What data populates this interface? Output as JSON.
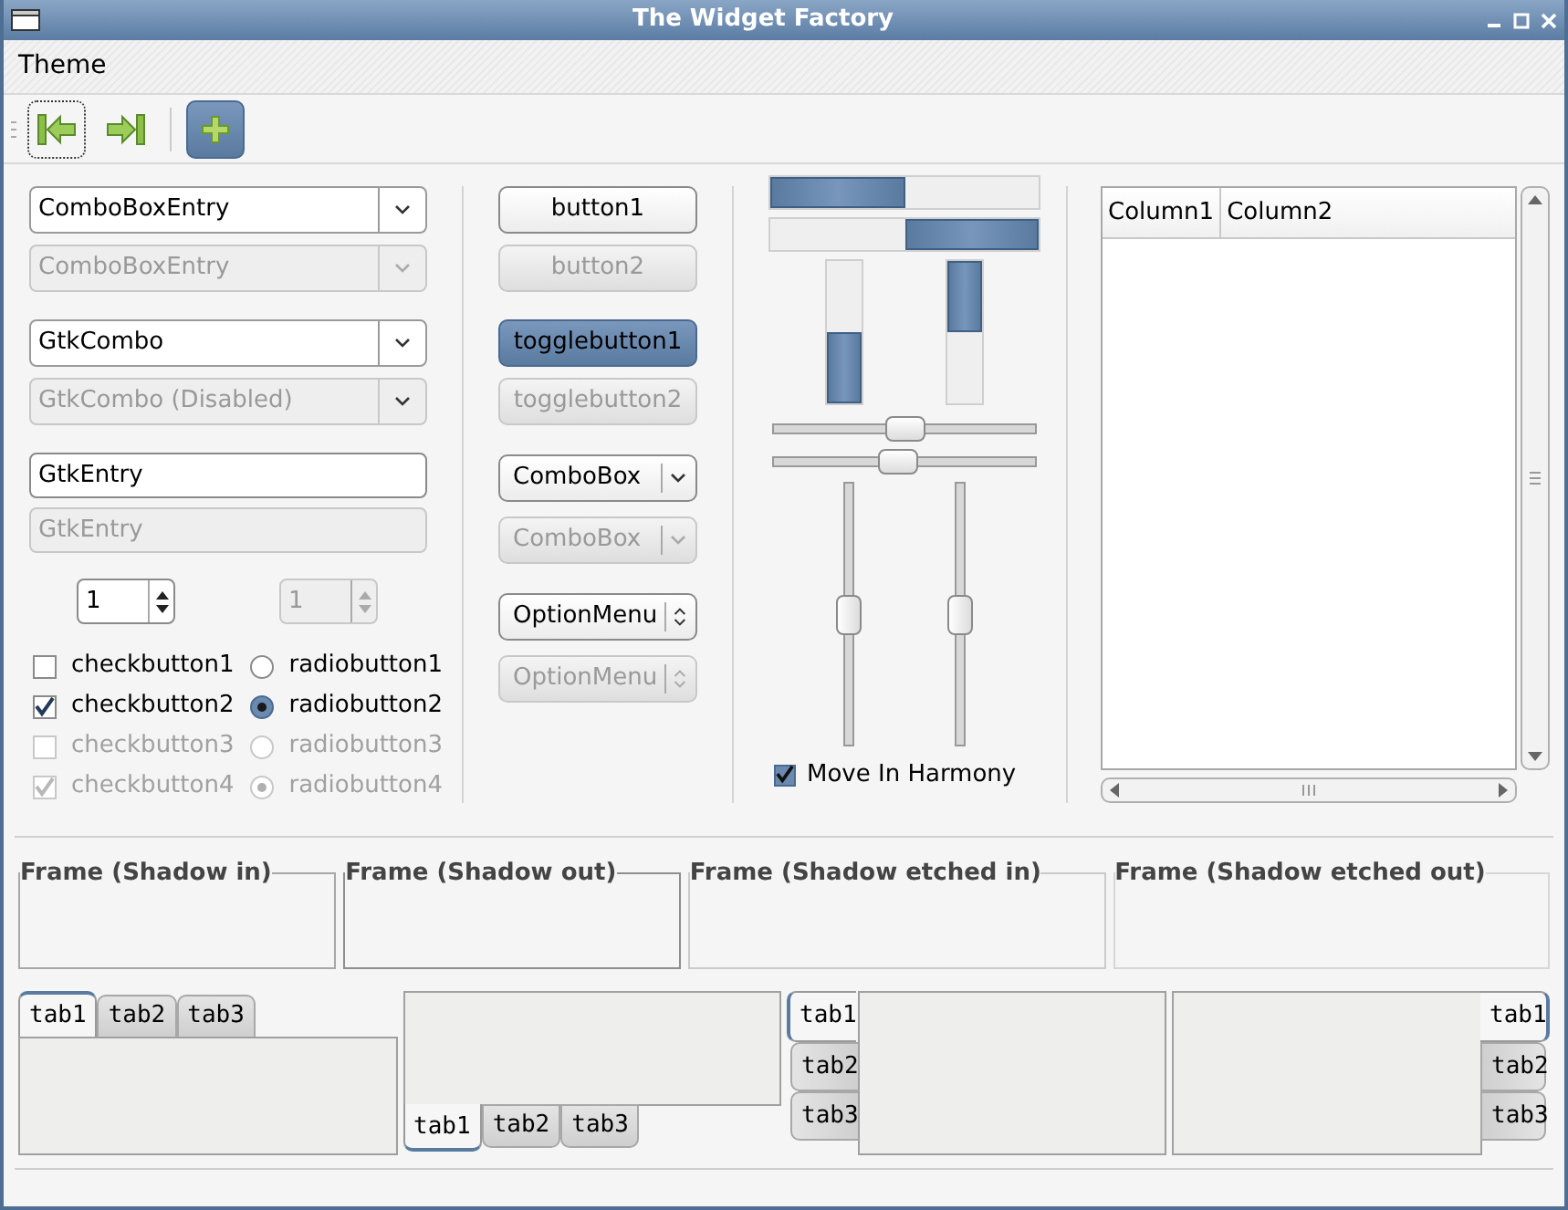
{
  "window": {
    "title": "The Widget Factory"
  },
  "menu": [
    {
      "label": "Theme"
    }
  ],
  "toolbar": [
    {
      "kind": "first",
      "focused": true,
      "active": false
    },
    {
      "kind": "last",
      "focused": false,
      "active": false
    },
    {
      "kind": "add",
      "focused": false,
      "active": true
    }
  ],
  "combo_entries": [
    {
      "kind": "combo-entry",
      "value": "ComboBoxEntry",
      "disabled": false
    },
    {
      "kind": "combo-entry",
      "value": "ComboBoxEntry",
      "disabled": true
    },
    {
      "kind": "gtk-combo",
      "value": "GtkCombo",
      "disabled": false
    },
    {
      "kind": "gtk-combo",
      "value": "GtkCombo (Disabled)",
      "disabled": true
    }
  ],
  "entries": [
    {
      "value": "GtkEntry",
      "disabled": false
    },
    {
      "value": "GtkEntry",
      "disabled": true
    }
  ],
  "spin_buttons": [
    {
      "value": "1",
      "disabled": false
    },
    {
      "value": "1",
      "disabled": true
    }
  ],
  "check_buttons": [
    {
      "label": "checkbutton1",
      "checked": false,
      "disabled": false
    },
    {
      "label": "checkbutton2",
      "checked": true,
      "disabled": false
    },
    {
      "label": "checkbutton3",
      "checked": false,
      "disabled": true
    },
    {
      "label": "checkbutton4",
      "checked": true,
      "disabled": true
    }
  ],
  "radio_buttons": [
    {
      "label": "radiobutton1",
      "selected": false,
      "disabled": false
    },
    {
      "label": "radiobutton2",
      "selected": true,
      "disabled": false
    },
    {
      "label": "radiobutton3",
      "selected": false,
      "disabled": true
    },
    {
      "label": "radiobutton4",
      "selected": true,
      "disabled": true
    }
  ],
  "buttons": [
    {
      "label": "button1",
      "disabled": false
    },
    {
      "label": "button2",
      "disabled": true
    }
  ],
  "toggle_buttons": [
    {
      "label": "togglebutton1",
      "on": true,
      "disabled": false
    },
    {
      "label": "togglebutton2",
      "on": false,
      "disabled": true
    }
  ],
  "combo_boxes": [
    {
      "kind": "combo",
      "value": "ComboBox",
      "disabled": false
    },
    {
      "kind": "combo",
      "value": "ComboBox",
      "disabled": true
    },
    {
      "kind": "option-menu",
      "value": "OptionMenu",
      "disabled": false
    },
    {
      "kind": "option-menu",
      "value": "OptionMenu",
      "disabled": true
    }
  ],
  "progress_bars": [
    {
      "kind": "left-to-right",
      "level": 0.5
    },
    {
      "kind": "right-to-left",
      "level": 0.5
    },
    {
      "kind": "bottom-to-top",
      "level": 0.5
    },
    {
      "kind": "top-to-bottom",
      "level": 0.5
    }
  ],
  "scales": [
    {
      "kind": "horizontal",
      "level": 0.5
    },
    {
      "kind": "horizontal",
      "level": 0.47
    },
    {
      "kind": "vertical",
      "level": 0.5
    },
    {
      "kind": "vertical",
      "level": 0.5
    }
  ],
  "harmony": {
    "label": "Move In Harmony",
    "checked": true
  },
  "tree": {
    "columns": [
      "Column1",
      "Column2"
    ]
  },
  "frames": [
    {
      "label": "Frame (Shadow in)",
      "kind": "in"
    },
    {
      "label": "Frame (Shadow out)",
      "kind": "out"
    },
    {
      "label": "Frame (Shadow etched in)",
      "kind": "etched-in"
    },
    {
      "label": "Frame (Shadow etched out)",
      "kind": "etched-out"
    }
  ],
  "notebooks": [
    {
      "kind": "top",
      "tabs": [
        {
          "label": "tab1",
          "selected": true
        },
        {
          "label": "tab2",
          "selected": false
        },
        {
          "label": "tab3",
          "selected": false
        }
      ]
    },
    {
      "kind": "bottom",
      "tabs": [
        {
          "label": "tab1",
          "selected": true
        },
        {
          "label": "tab2",
          "selected": false
        },
        {
          "label": "tab3",
          "selected": false
        }
      ]
    },
    {
      "kind": "left",
      "tabs": [
        {
          "label": "tab1",
          "selected": true
        },
        {
          "label": "tab2",
          "selected": false
        },
        {
          "label": "tab3",
          "selected": false
        }
      ]
    },
    {
      "kind": "right",
      "tabs": [
        {
          "label": "tab1",
          "selected": true
        },
        {
          "label": "tab2",
          "selected": false
        },
        {
          "label": "tab3",
          "selected": false
        }
      ]
    }
  ]
}
